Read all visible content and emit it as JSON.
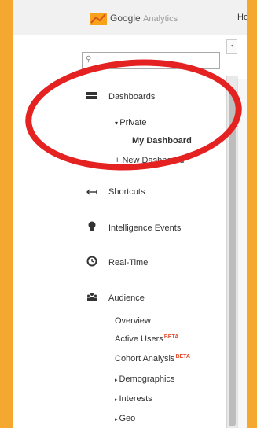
{
  "header": {
    "logo_google": "Google",
    "logo_analytics": "Analytics",
    "home_tab": "Ho"
  },
  "sidebar": {
    "collapse_label": "◂",
    "items": {
      "dashboards": "Dashboards",
      "private": "Private",
      "my_dashboard": "My Dashboard",
      "new_dashboard": "New Dashboard",
      "shortcuts": "Shortcuts",
      "intelligence": "Intelligence Events",
      "realtime": "Real-Time",
      "audience": "Audience",
      "overview": "Overview",
      "active_users": "Active Users",
      "cohort_analysis": "Cohort Analysis",
      "beta": "BETA",
      "demographics": "Demographics",
      "interests": "Interests",
      "geo": "Geo"
    }
  },
  "annotation": {
    "color": "#e52222"
  },
  "colors": {
    "frame": "#f5a830",
    "beta": "#e34d2f"
  },
  "icons": [
    "grid-icon",
    "arrow-shortcut-icon",
    "lightbulb-icon",
    "clock-icon",
    "people-icon",
    "search-icon"
  ]
}
